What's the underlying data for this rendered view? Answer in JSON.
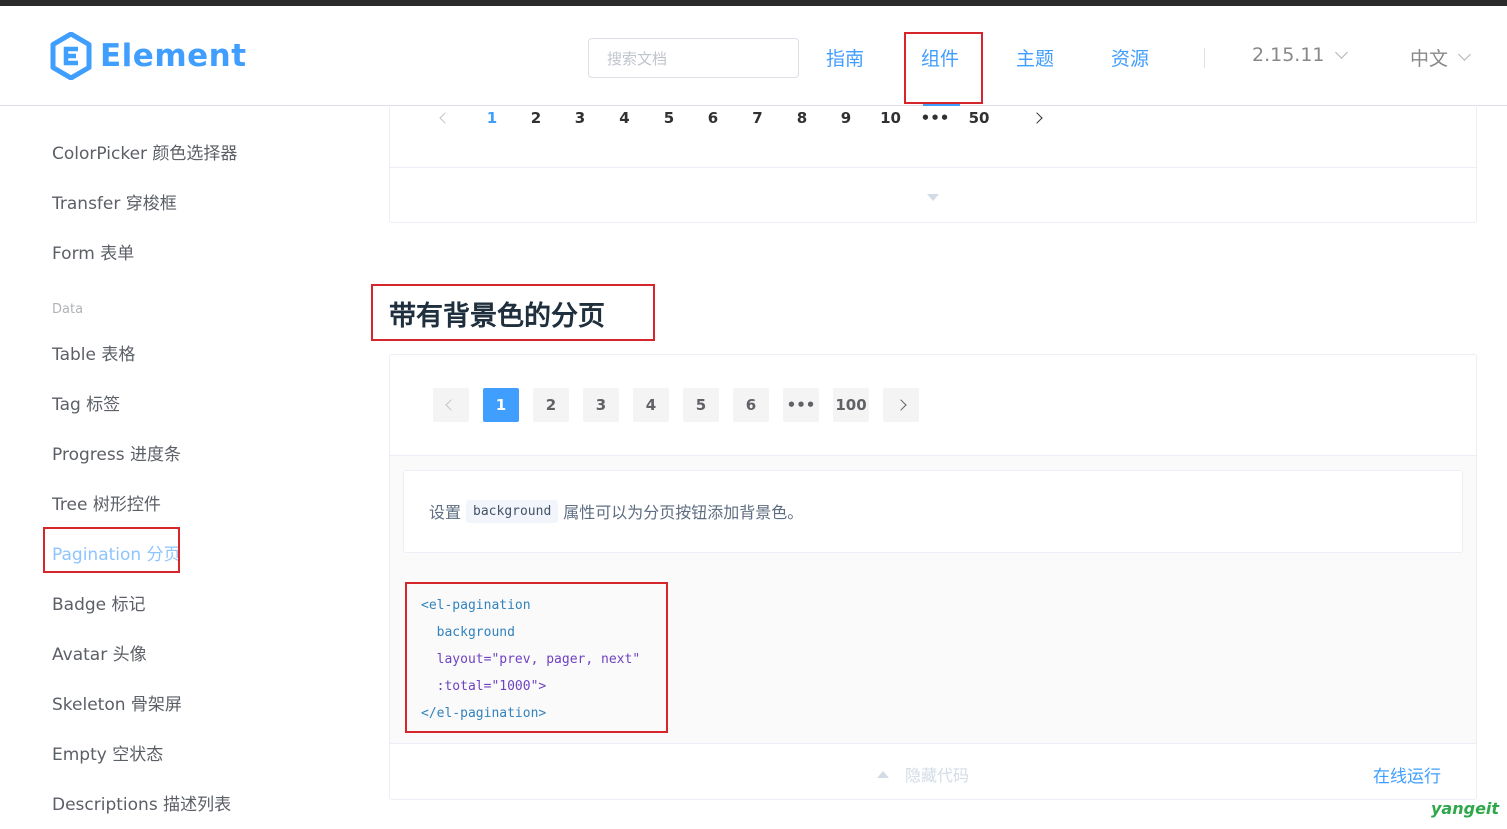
{
  "header": {
    "logo_text": "Element",
    "search_placeholder": "搜索文档",
    "nav": [
      "指南",
      "组件",
      "主题",
      "资源"
    ],
    "version": "2.15.11",
    "language": "中文"
  },
  "sidebar": {
    "group_label": "Data",
    "items_top": [
      "ColorPicker 颜色选择器",
      "Transfer 穿梭框",
      "Form 表单"
    ],
    "items_data": [
      "Table 表格",
      "Tag 标签",
      "Progress 进度条",
      "Tree 树形控件",
      "Pagination 分页",
      "Badge 标记",
      "Avatar 头像",
      "Skeleton 骨架屏",
      "Empty 空状态",
      "Descriptions 描述列表"
    ]
  },
  "pager_top": [
    "1",
    "2",
    "3",
    "4",
    "5",
    "6",
    "7",
    "8",
    "9",
    "10",
    "•••",
    "50"
  ],
  "section": {
    "title": "带有背景色的分页",
    "pager": [
      "1",
      "2",
      "3",
      "4",
      "5",
      "6",
      "•••",
      "100"
    ],
    "desc_before": "设置",
    "desc_code": "background",
    "desc_after": "属性可以为分页按钮添加背景色。",
    "code_lines": [
      "<el-pagination",
      "  background",
      "  layout=\"prev, pager, next\"",
      "  :total=\"1000\">",
      "</el-pagination>"
    ],
    "hide_code": "隐藏代码",
    "run_online": "在线运行"
  },
  "watermark": "yangeit",
  "colors": {
    "primary": "#409eff",
    "annotation_red": "#d6262c"
  }
}
